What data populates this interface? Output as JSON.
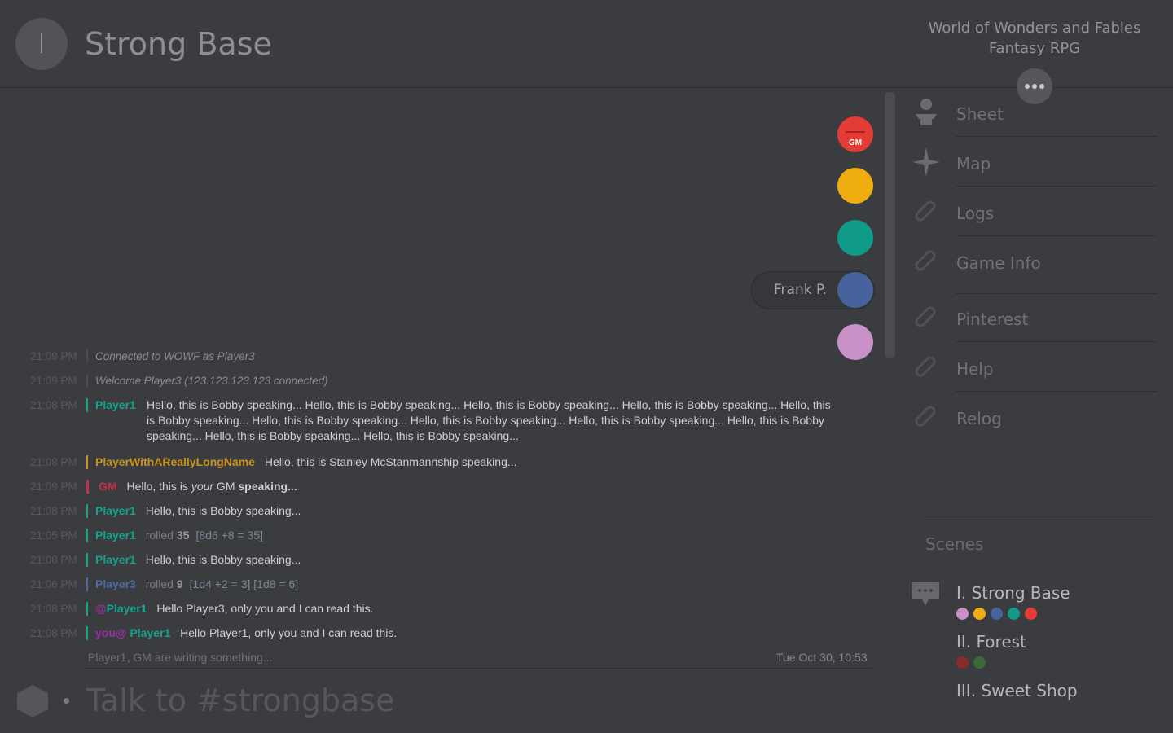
{
  "header": {
    "badge": "I",
    "scene_title": "Strong Base",
    "game_line1": "World of Wonders and Fables",
    "game_line2": "Fantasy RPG"
  },
  "presence": {
    "gm_label": "GM",
    "hover_name": "Frank P.",
    "colors": [
      "#e33b35",
      "#f0ad0f",
      "#0f9b88",
      "#48629c",
      "#c892c8"
    ]
  },
  "messages": [
    {
      "time": "21:09 PM",
      "text": "Connected to WOWF as Player3"
    },
    {
      "time": "21:09 PM",
      "text": "Welcome Player3 (123.123.123.123 connected)"
    },
    {
      "time": "21:08 PM",
      "who": "Player1",
      "text": "Hello, this is Bobby speaking... Hello, this is Bobby speaking... Hello, this is Bobby speaking... Hello, this is Bobby speaking... Hello, this is Bobby speaking... Hello, this is Bobby speaking... Hello, this is Bobby speaking... Hello, this is Bobby speaking... Hello, this is Bobby speaking...  Hello, this is Bobby speaking... Hello, this is Bobby speaking..."
    },
    {
      "time": "21:08 PM",
      "who": "PlayerWithAReallyLongName",
      "text": "Hello, this is Stanley McStanmannship speaking..."
    },
    {
      "time": "21:09 PM",
      "who": "GM",
      "t1": "Hello, this is ",
      "t2": "your",
      "t3": " GM ",
      "t4": "speaking..."
    },
    {
      "time": "21:08 PM",
      "who": "Player1",
      "text": "Hello, this is Bobby speaking..."
    },
    {
      "time": "21:05 PM",
      "who": "Player1",
      "action": "rolled",
      "value": "35",
      "detail": "[8d6 +8 = 35]"
    },
    {
      "time": "21:08 PM",
      "who": "Player1",
      "text": "Hello, this is Bobby speaking..."
    },
    {
      "time": "21:06 PM",
      "who": "Player3",
      "action": "rolled",
      "value": "9",
      "detail": "[1d4 +2 = 3] [1d8 = 6]"
    },
    {
      "time": "21:08 PM",
      "at": "@",
      "who": "Player1",
      "text": "Hello Player3, only you and I can read this."
    },
    {
      "time": "21:08 PM",
      "at": "you@",
      "who": "Player1",
      "text": "Hello Player1, only you and I can read this."
    }
  ],
  "status": {
    "typing": "Player1, GM are writing something...",
    "datetime": "Tue Oct 30, 10:53"
  },
  "input": {
    "placeholder": "Talk to #strongbase"
  },
  "menu": [
    "Sheet",
    "Map",
    "Logs",
    "Game Info",
    "Pinterest",
    "Help",
    "Relog"
  ],
  "scenes": {
    "header": "Scenes",
    "items": [
      {
        "name": "I. Strong Base",
        "dots": [
          "#c892c8",
          "#f0ad0f",
          "#48629c",
          "#0f9b88",
          "#e33b35"
        ]
      },
      {
        "name": "II. Forest",
        "dots": [
          "#8a2b2b",
          "#3b6b34"
        ]
      },
      {
        "name": "III. Sweet Shop",
        "dots": []
      }
    ]
  },
  "colors": {
    "player1": "#12a38c",
    "long_name": "#c8941c",
    "gm": "#c2314a",
    "player3": "#4d6aa3",
    "whisper": "#9b2fa3"
  }
}
